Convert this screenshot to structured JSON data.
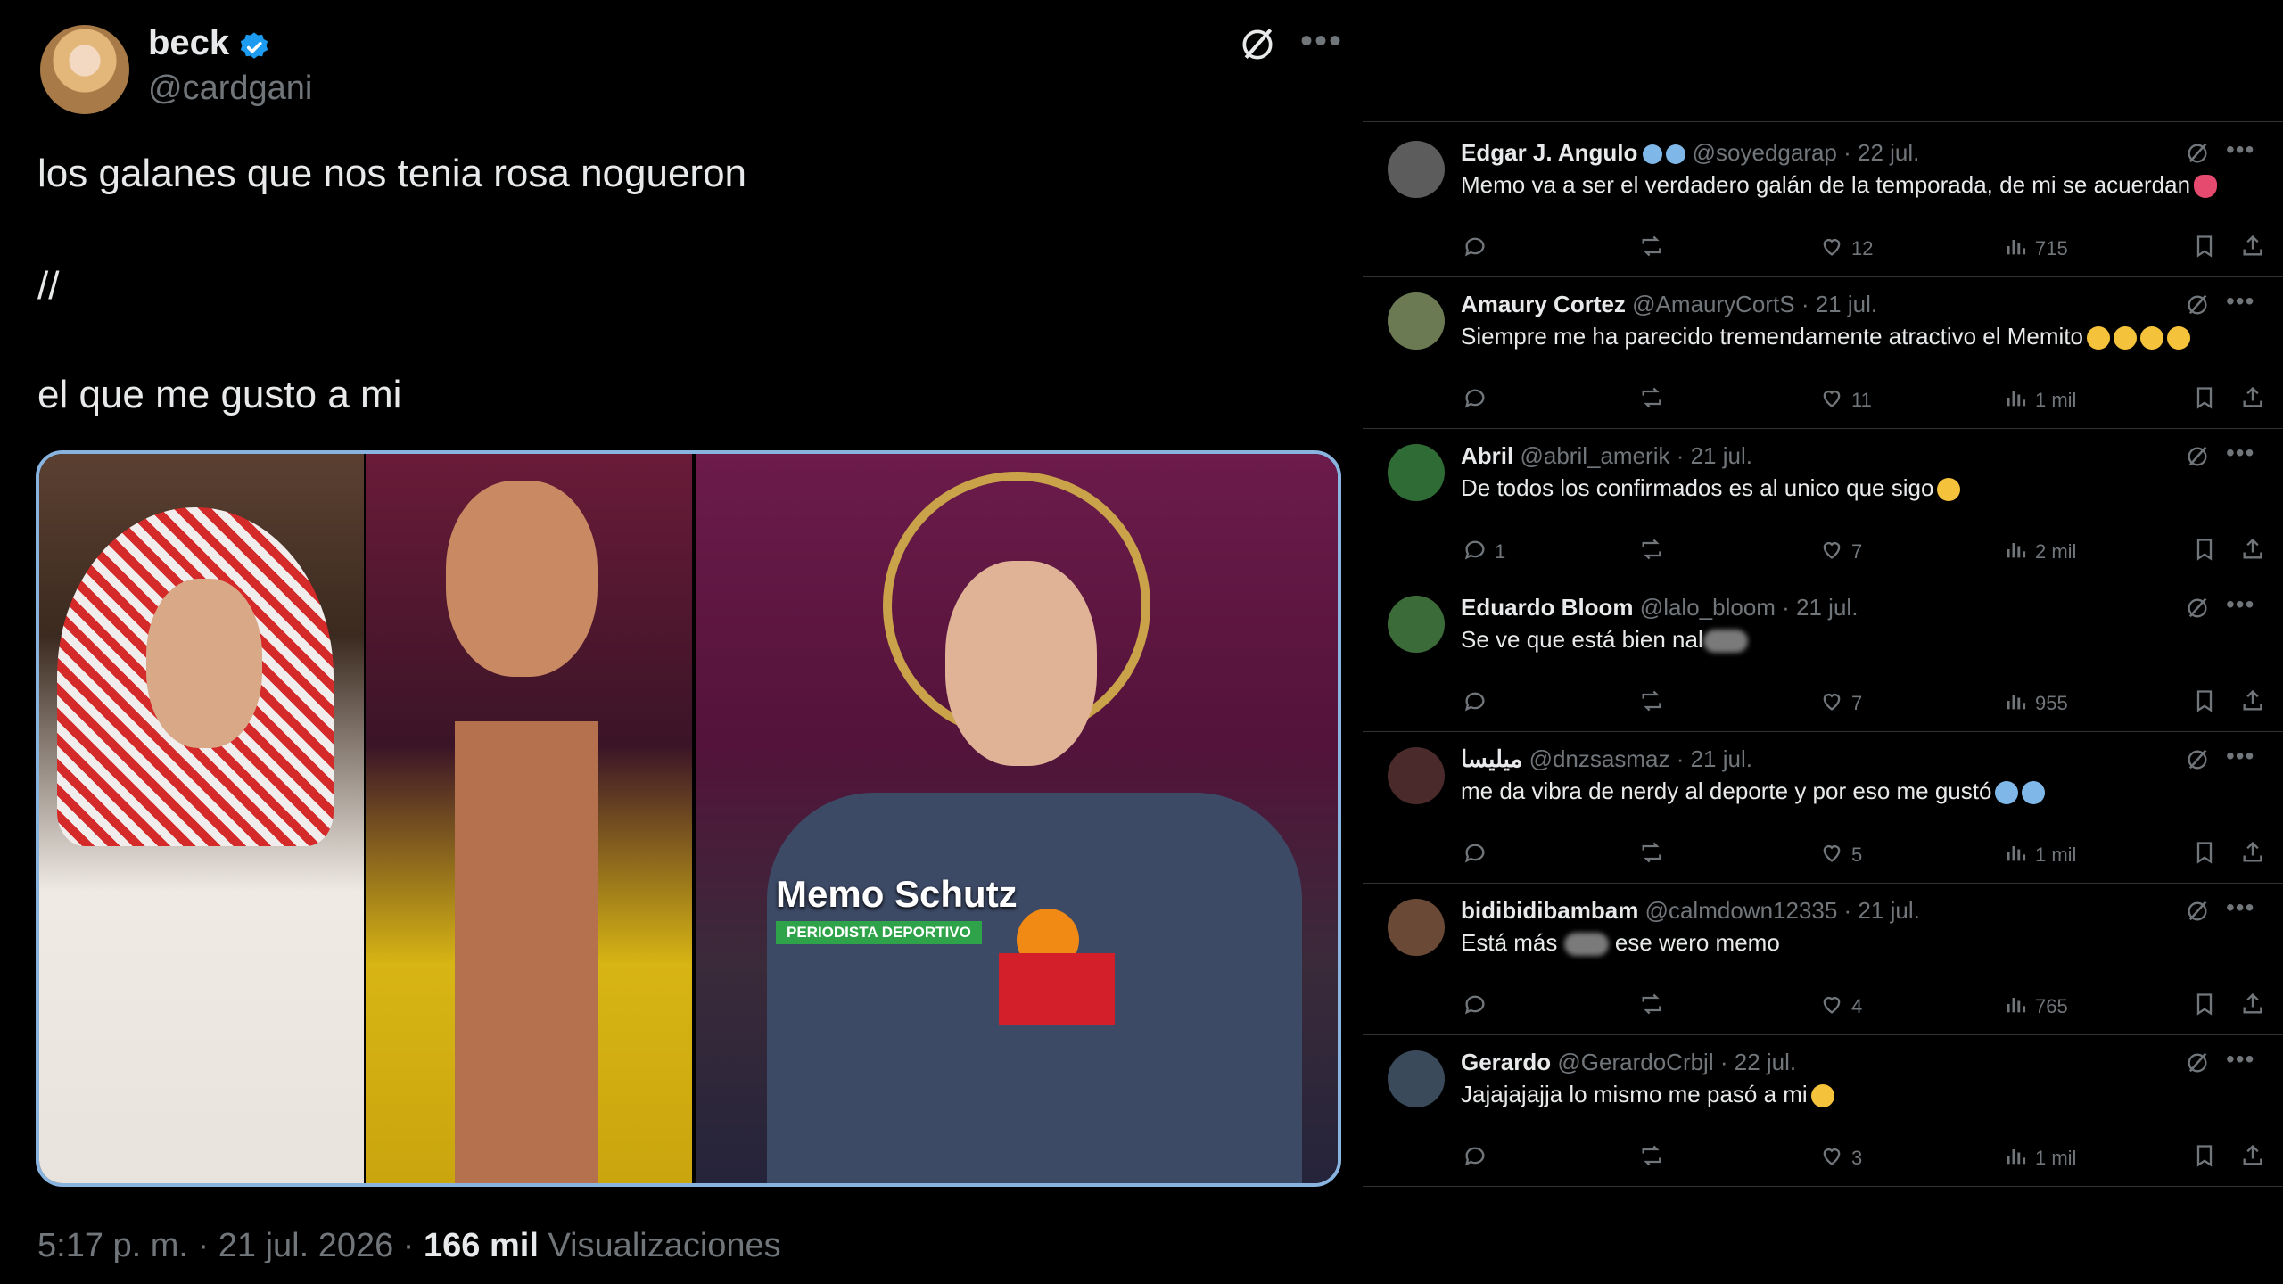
{
  "tweet": {
    "author_name": "beck",
    "author_handle": "@cardgani",
    "line1": "los galanes que nos tenia rosa nogueron",
    "line2": "//",
    "line3": "el que me gusto a mi",
    "media_caption_name": "Memo Schutz",
    "media_caption_role": "PERIODISTA DEPORTIVO",
    "timestamp": "5:17 p. m. · 21 jul. 2026 · ",
    "views_count": "166 mil",
    "views_label": " Visualizaciones"
  },
  "icons": {
    "verified": "verified-badge-icon",
    "grok": "grok-icon",
    "more": "more-icon",
    "reply": "reply-icon",
    "retweet": "retweet-icon",
    "like": "like-icon",
    "views": "views-icon",
    "bookmark": "bookmark-icon",
    "share": "share-icon"
  },
  "colors": {
    "verified": "#1d9bf0",
    "muted": "#71767b",
    "text": "#e7e9ea",
    "border": "#2f3336"
  },
  "replies": [
    {
      "name": "Edgar J. Angulo",
      "handle": "@soyedgarap",
      "date": " · 22 jul.",
      "text": "Memo va a ser el verdadero galán de la temporada, de mi se acuerdan",
      "reply_count": "",
      "likes": "12",
      "views": "715",
      "avatar_color": "#5c5c5c"
    },
    {
      "name": "Amaury Cortez",
      "handle": "@AmauryCortS",
      "date": " · 21 jul.",
      "text": "Siempre me ha parecido tremendamente atractivo el Memito",
      "reply_count": "",
      "likes": "11",
      "views": "1 mil",
      "avatar_color": "#6c7a54"
    },
    {
      "name": "Abril",
      "handle": "@abril_amerik",
      "date": " · 21 jul.",
      "text": "De todos los confirmados es al unico que sigo",
      "reply_count": "1",
      "likes": "7",
      "views": "2 mil",
      "avatar_color": "#2f6b35"
    },
    {
      "name": "Eduardo Bloom",
      "handle": "@lalo_bloom",
      "date": " · 21 jul.",
      "text": "Se ve que está bien nal",
      "reply_count": "",
      "likes": "7",
      "views": "955",
      "avatar_color": "#3c6b3a"
    },
    {
      "name": "ميليسا",
      "handle": "@dnzsasmaz",
      "date": " · 21 jul.",
      "text": "me da vibra de nerdy al deporte y por eso me gustó",
      "reply_count": "",
      "likes": "5",
      "views": "1 mil",
      "avatar_color": "#4a2a2a"
    },
    {
      "name": "bidibidibambam",
      "handle": "@calmdown12335",
      "date": " · 21 jul.",
      "text_a": "Está más ",
      "text_b": " ese wero memo",
      "reply_count": "",
      "likes": "4",
      "views": "765",
      "avatar_color": "#6a4a36"
    },
    {
      "name": "Gerardo",
      "handle": "@GerardoCrbjl",
      "date": " · 22 jul.",
      "text": "Jajajajajja lo mismo me pasó a mi",
      "reply_count": "",
      "likes": "3",
      "views": "1 mil",
      "avatar_color": "#3a4a5a"
    }
  ]
}
